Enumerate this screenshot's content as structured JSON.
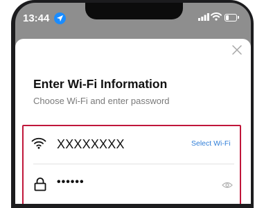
{
  "status_bar": {
    "time": "13:44",
    "icons": [
      "location-arrow-icon",
      "cellular-signal-icon",
      "wifi-icon",
      "battery-icon"
    ],
    "battery_level": 0.25
  },
  "dialog": {
    "close_icon": "close-icon",
    "title": "Enter Wi-Fi Information",
    "subtitle": "Choose Wi-Fi and enter password",
    "wifi": {
      "icon": "wifi-icon",
      "ssid_value": "XXXXXXXX",
      "select_label": "Select Wi-Fi"
    },
    "password": {
      "icon": "lock-icon",
      "masked_value": "••••••",
      "toggle_icon": "eye-icon"
    }
  },
  "colors": {
    "highlight_border": "#c0163a",
    "link": "#2f7ed8",
    "location_badge": "#1a8cff"
  }
}
